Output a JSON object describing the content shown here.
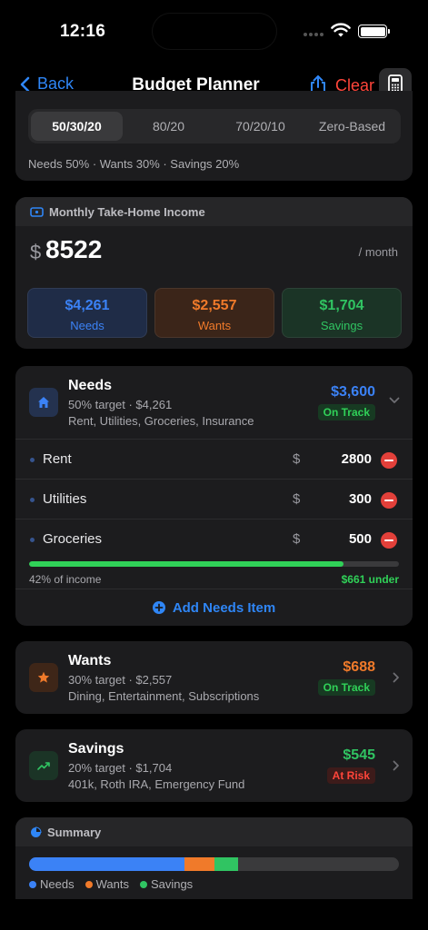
{
  "status": {
    "time": "12:16"
  },
  "nav": {
    "back": "Back",
    "title": "Budget Planner",
    "clear": "Clear"
  },
  "rules": {
    "options": [
      "50/30/20",
      "80/20",
      "70/20/10",
      "Zero-Based"
    ],
    "selected": 0,
    "split_text": "Needs 50% · Wants 30% · Savings 20%"
  },
  "income": {
    "header": "Monthly Take-Home Income",
    "currency": "$",
    "amount": "8522",
    "period": "/ month",
    "tiles": [
      {
        "value": "$4,261",
        "label": "Needs",
        "color": "#3b82f6"
      },
      {
        "value": "$2,557",
        "label": "Wants",
        "color": "#f07a2a"
      },
      {
        "value": "$1,704",
        "label": "Savings",
        "color": "#30c462"
      }
    ]
  },
  "needs": {
    "name": "Needs",
    "sub": "50% target · $4,261",
    "items_text": "Rent, Utilities, Groceries, Insurance",
    "amount": "$3,600",
    "badge": "On Track",
    "rows": [
      {
        "label": "Rent",
        "currency": "$",
        "value": "2800"
      },
      {
        "label": "Utilities",
        "currency": "$",
        "value": "300"
      },
      {
        "label": "Groceries",
        "currency": "$",
        "value": "500"
      }
    ],
    "progress_fraction": 0.85,
    "progress_left": "42% of income",
    "progress_right": "$661 under",
    "add_label": "Add Needs Item"
  },
  "wants": {
    "name": "Wants",
    "sub": "30% target · $2,557",
    "items_text": "Dining, Entertainment, Subscriptions",
    "amount": "$688",
    "badge": "On Track"
  },
  "savings": {
    "name": "Savings",
    "sub": "20% target · $1,704",
    "items_text": "401k, Roth IRA, Emergency Fund",
    "amount": "$545",
    "badge": "At Risk"
  },
  "summary": {
    "header": "Summary",
    "segments": [
      {
        "name": "Needs",
        "fraction": 0.42,
        "color": "#3b82f6"
      },
      {
        "name": "Wants",
        "fraction": 0.081,
        "color": "#f07a2a"
      },
      {
        "name": "Savings",
        "fraction": 0.064,
        "color": "#30c462"
      }
    ],
    "legend": [
      "Needs",
      "Wants",
      "Savings"
    ]
  },
  "colors": {
    "blue": "#2f86f6",
    "orange": "#f07a2a",
    "green": "#30d158",
    "red": "#ff453a"
  }
}
